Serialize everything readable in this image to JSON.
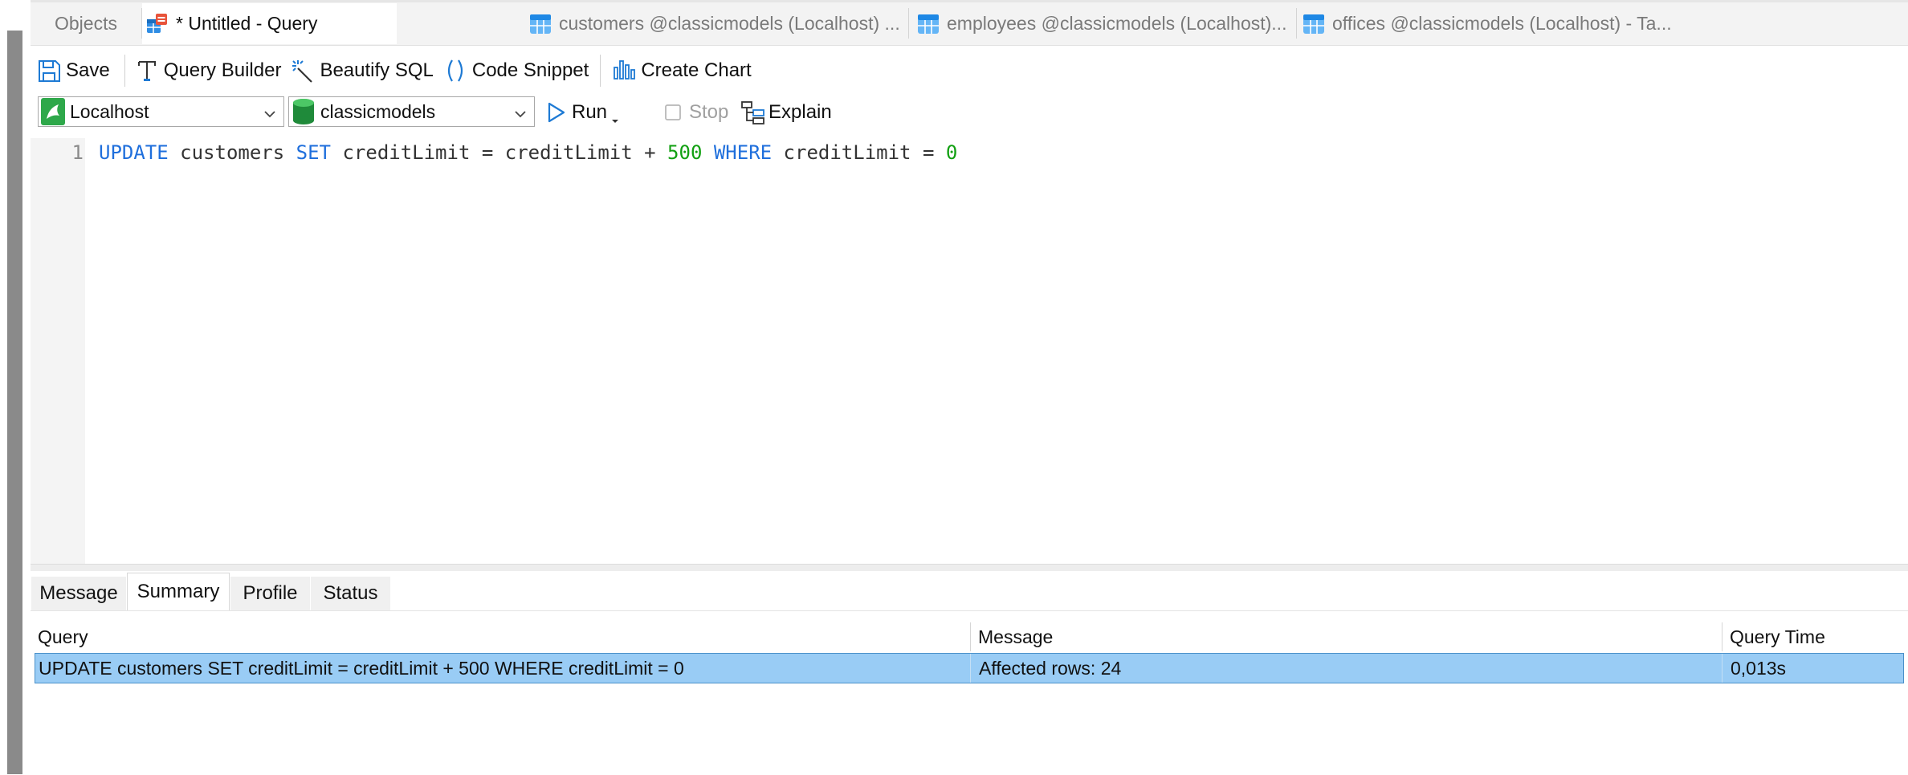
{
  "tabs": [
    {
      "label": "Objects",
      "icon": "none",
      "active": false
    },
    {
      "label": "* Untitled - Query",
      "icon": "query-icon",
      "active": true
    },
    {
      "label": "customers @classicmodels (Localhost) ...",
      "icon": "table-icon",
      "active": false
    },
    {
      "label": "employees @classicmodels (Localhost)...",
      "icon": "table-icon",
      "active": false
    },
    {
      "label": "offices @classicmodels (Localhost) - Ta...",
      "icon": "table-icon",
      "active": false
    }
  ],
  "toolbar": {
    "save": "Save",
    "query_builder": "Query Builder",
    "beautify": "Beautify SQL",
    "code_snippet": "Code Snippet",
    "create_chart": "Create Chart"
  },
  "connection": {
    "server": "Localhost",
    "database": "classicmodels",
    "run": "Run",
    "stop": "Stop",
    "explain": "Explain"
  },
  "editor": {
    "line_number": "1",
    "tokens": {
      "t1": "UPDATE",
      "t2": " customers ",
      "t3": "SET",
      "t4": " creditLimit = creditLimit + ",
      "t5": "500",
      "t6": " ",
      "t7": "WHERE",
      "t8": " creditLimit = ",
      "t9": "0"
    }
  },
  "result_tabs": [
    {
      "label": "Message",
      "active": false
    },
    {
      "label": "Summary",
      "active": true
    },
    {
      "label": "Profile",
      "active": false
    },
    {
      "label": "Status",
      "active": false
    }
  ],
  "summary": {
    "columns": [
      "Query",
      "Message",
      "Query Time"
    ],
    "rows": [
      {
        "query": "UPDATE customers SET creditLimit = creditLimit + 500 WHERE creditLimit = 0",
        "message": "Affected rows: 24",
        "time": "0,013s"
      }
    ]
  },
  "colors": {
    "keyword": "#1f6fdc",
    "number": "#12a012",
    "selection": "#99ccf5"
  }
}
